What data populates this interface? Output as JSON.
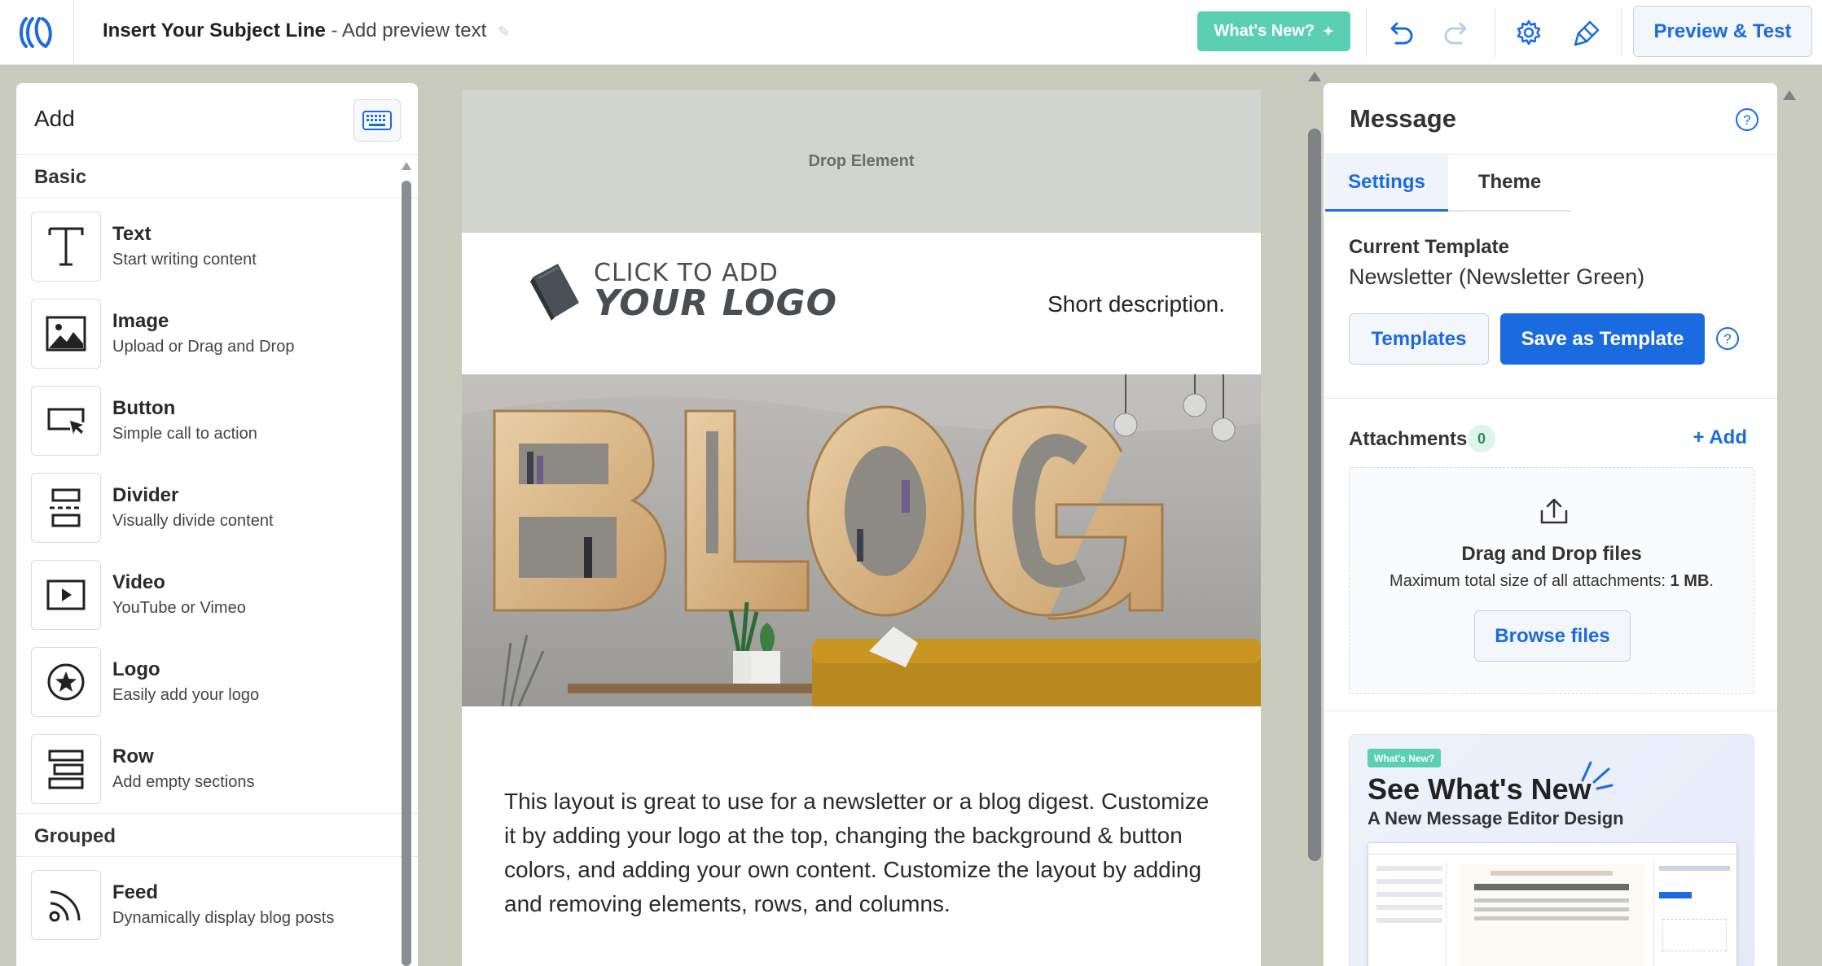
{
  "topbar": {
    "subject_line": "Insert Your Subject Line",
    "separator": " - ",
    "preview_text": "Add preview text",
    "whats_new_label": "What's New?",
    "preview_test_label": "Preview & Test"
  },
  "left_panel": {
    "title": "Add",
    "basic_title": "Basic",
    "grouped_title": "Grouped",
    "basic_items": [
      {
        "name": "Text",
        "desc": "Start writing content",
        "icon": "text-icon"
      },
      {
        "name": "Image",
        "desc": "Upload or Drag and Drop",
        "icon": "image-icon"
      },
      {
        "name": "Button",
        "desc": "Simple call to action",
        "icon": "button-icon"
      },
      {
        "name": "Divider",
        "desc": "Visually divide content",
        "icon": "divider-icon"
      },
      {
        "name": "Video",
        "desc": "YouTube or Vimeo",
        "icon": "video-icon"
      },
      {
        "name": "Logo",
        "desc": "Easily add your logo",
        "icon": "logo-icon"
      },
      {
        "name": "Row",
        "desc": "Add empty sections",
        "icon": "row-icon"
      }
    ],
    "grouped_items": [
      {
        "name": "Feed",
        "desc": "Dynamically display blog posts",
        "icon": "feed-icon"
      }
    ]
  },
  "email": {
    "drop_label": "Drop Element",
    "logo_line1": "CLICK TO ADD",
    "logo_line2": "YOUR LOGO",
    "short_description": "Short description.",
    "hero_word": "BLOG",
    "body_text": "This layout is great to use for a newsletter or a blog digest. Customize it by adding your logo at the top, changing the background & button colors, and adding your own content. Customize the layout by adding and removing elements, rows, and columns."
  },
  "right_panel": {
    "title": "Message",
    "tabs": [
      {
        "label": "Settings",
        "active": true
      },
      {
        "label": "Theme",
        "active": false
      }
    ],
    "current_template_label": "Current Template",
    "current_template_value": "Newsletter (Newsletter Green)",
    "templates_label": "Templates",
    "save_template_label": "Save as Template",
    "attachments_label": "Attachments",
    "attachments_count": "0",
    "add_label": "+ Add",
    "drag_drop_title": "Drag and Drop files",
    "max_size_text": "Maximum total size of all attachments:",
    "max_size_value": "1 MB",
    "max_size_end": ".",
    "browse_label": "Browse files",
    "promo": {
      "badge": "What's New?",
      "title": "See What's New",
      "subtitle": "A New Message Editor Design"
    }
  },
  "colors": {
    "accent_blue": "#1b6be0",
    "whats_new_green": "#5bcfb4",
    "canvas_bg": "#c9cbbf",
    "drop_zone_bg": "#d2d4ce"
  }
}
